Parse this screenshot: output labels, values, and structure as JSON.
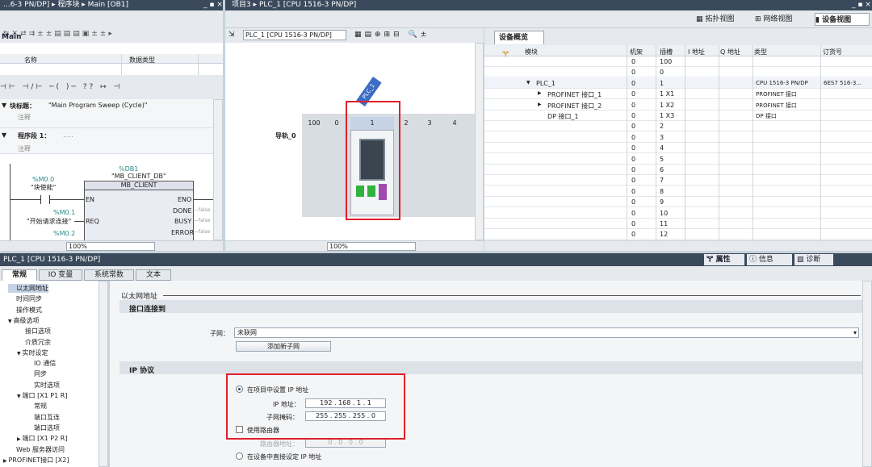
{
  "left_editor": {
    "title": "...6-3 PN/DP] ▸ 程序块 ▸ Main [OB1]",
    "block_name": "Main",
    "col_name": "名称",
    "col_type": "数据类型",
    "block_title_label": "块标题：",
    "block_title_value": "\"Main Program Sweep (Cycle)\"",
    "comment1": "注释",
    "network_label": "程序段 1：",
    "network_dots": ".....",
    "comment2": "注释",
    "db_name": "%DB1",
    "db_label": "\"MB_CLIENT_DB\"",
    "fb_name": "MB_CLIENT",
    "contact1_addr": "%M0.0",
    "contact1_name": "\"块使能\"",
    "contact2_addr": "%M0.1",
    "contact2_name": "\"开始请求连接\"",
    "contact3_addr": "%M0.2",
    "pin_en": "EN",
    "pin_req": "REQ",
    "pin_eno": "ENO",
    "pin_done": "DONE",
    "pin_busy": "BUSY",
    "pin_error": "ERROR",
    "pin_out_suffix": "—false",
    "zoom": "100%"
  },
  "device_view": {
    "title": "项目3 ▸ PLC_1 [CPU 1516-3 PN/DP]",
    "tab_topology": "拓扑视图",
    "tab_network": "网络视图",
    "tab_device": "设备视图",
    "device_select": "PLC_1 [CPU 1516-3 PN/DP]",
    "plc_tag": "PLC_1",
    "rail_label": "导轨_0",
    "slots": [
      "100",
      "0",
      "1",
      "2",
      "3",
      "4"
    ],
    "zoom": "100%"
  },
  "device_overview": {
    "title": "设备概览",
    "headers": [
      "模块",
      "机架",
      "插槽",
      "I 地址",
      "Q 地址",
      "类型",
      "订货号"
    ],
    "rows": [
      {
        "module": "",
        "rack": "0",
        "slot": "100",
        "type": "",
        "order": ""
      },
      {
        "module": "",
        "rack": "0",
        "slot": "0",
        "type": "",
        "order": ""
      },
      {
        "module": "PLC_1",
        "rack": "0",
        "slot": "1",
        "type": "CPU 1516-3 PN/DP",
        "order": "6ES7 516-3..."
      },
      {
        "module": "PROFINET 接口_1",
        "rack": "0",
        "slot": "1 X1",
        "type": "PROFINET 接口",
        "order": ""
      },
      {
        "module": "PROFINET 接口_2",
        "rack": "0",
        "slot": "1 X2",
        "type": "PROFINET 接口",
        "order": ""
      },
      {
        "module": "DP 接口_1",
        "rack": "0",
        "slot": "1 X3",
        "type": "DP 接口",
        "order": ""
      },
      {
        "module": "",
        "rack": "0",
        "slot": "2",
        "type": "",
        "order": ""
      },
      {
        "module": "",
        "rack": "0",
        "slot": "3",
        "type": "",
        "order": ""
      },
      {
        "module": "",
        "rack": "0",
        "slot": "4",
        "type": "",
        "order": ""
      },
      {
        "module": "",
        "rack": "0",
        "slot": "5",
        "type": "",
        "order": ""
      },
      {
        "module": "",
        "rack": "0",
        "slot": "6",
        "type": "",
        "order": ""
      },
      {
        "module": "",
        "rack": "0",
        "slot": "7",
        "type": "",
        "order": ""
      },
      {
        "module": "",
        "rack": "0",
        "slot": "8",
        "type": "",
        "order": ""
      },
      {
        "module": "",
        "rack": "0",
        "slot": "9",
        "type": "",
        "order": ""
      },
      {
        "module": "",
        "rack": "0",
        "slot": "10",
        "type": "",
        "order": ""
      },
      {
        "module": "",
        "rack": "0",
        "slot": "11",
        "type": "",
        "order": ""
      },
      {
        "module": "",
        "rack": "0",
        "slot": "12",
        "type": "",
        "order": ""
      }
    ]
  },
  "inspector": {
    "title": "PLC_1 [CPU 1516-3 PN/DP]",
    "tab_properties": "属性",
    "tab_info": "信息",
    "tab_diag": "诊断",
    "tabs": [
      "常规",
      "IO 变量",
      "系统常数",
      "文本"
    ],
    "nav": [
      {
        "label": "以太网地址",
        "indent": 0
      },
      {
        "label": "时间同步",
        "indent": 0
      },
      {
        "label": "操作模式",
        "indent": 0
      },
      {
        "label": "高级选项",
        "indent": 0,
        "exp": "▼"
      },
      {
        "label": "接口选项",
        "indent": 1
      },
      {
        "label": "介质冗余",
        "indent": 1
      },
      {
        "label": "实时设定",
        "indent": 1,
        "exp": "▼"
      },
      {
        "label": "IO 通信",
        "indent": 2
      },
      {
        "label": "同步",
        "indent": 2
      },
      {
        "label": "实时选项",
        "indent": 2
      },
      {
        "label": "端口 [X1 P1 R]",
        "indent": 1,
        "exp": "▼"
      },
      {
        "label": "常规",
        "indent": 2
      },
      {
        "label": "端口互连",
        "indent": 2
      },
      {
        "label": "端口选项",
        "indent": 2
      },
      {
        "label": "端口 [X1 P2 R]",
        "indent": 1,
        "exp": "▶"
      },
      {
        "label": "Web 服务器访问",
        "indent": 0
      },
      {
        "label": "PROFINET接口 [X2]",
        "indent": -1,
        "exp": "▶"
      }
    ],
    "section_title": "以太网地址",
    "iface_group": "接口连接到",
    "subnet_label": "子网：",
    "subnet_value": "未联网",
    "add_subnet_btn": "添加新子网",
    "ip_group": "IP 协议",
    "radio_project": "在项目中设置 IP 地址",
    "ip_label": "IP 地址：",
    "ip": [
      "192",
      "168",
      "1",
      "1"
    ],
    "mask_label": "子网掩码：",
    "mask": [
      "255",
      "255",
      "255",
      "0"
    ],
    "use_router": "使用路由器",
    "router_label": "路由器地址：",
    "router": [
      "0",
      "0",
      "0",
      "0"
    ],
    "radio_device": "在设备中直接设定 IP 地址"
  }
}
